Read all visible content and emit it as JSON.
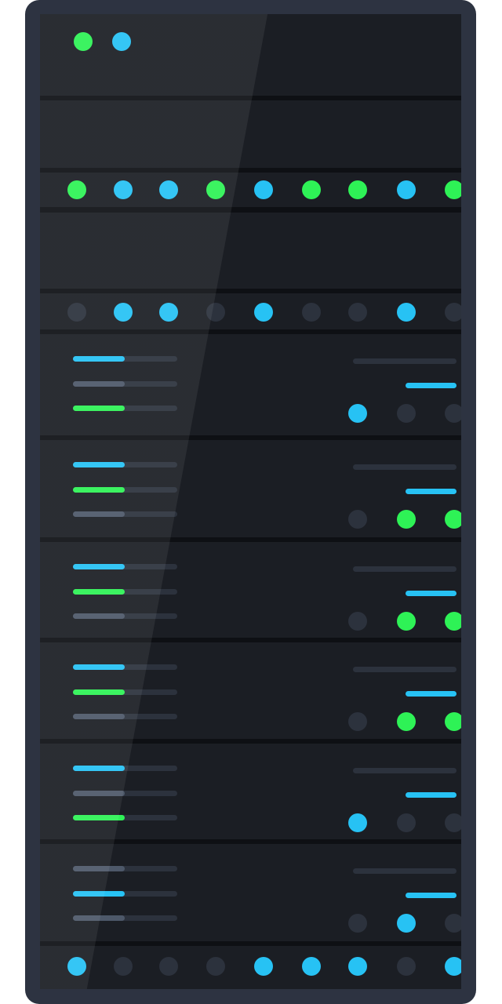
{
  "colors": {
    "frame": "#2d3341",
    "chassis": "#0e1014",
    "panel": "#1b1e24",
    "green": "#2ef256",
    "blue": "#27c2f4",
    "gray": "#4d5869",
    "off": "#2c323d"
  },
  "top_unit": {
    "leds": [
      "green",
      "blue"
    ]
  },
  "led_rows": [
    {
      "leds": [
        "green",
        "blue",
        "blue",
        "green",
        "blue",
        "green",
        "green",
        "blue",
        "green"
      ]
    },
    {
      "leds": [
        "off",
        "blue",
        "blue",
        "off",
        "blue",
        "off",
        "off",
        "blue",
        "off"
      ]
    },
    {
      "leds": [
        "blue",
        "off",
        "off",
        "off",
        "blue",
        "blue",
        "blue",
        "off",
        "blue"
      ]
    }
  ],
  "drive_units": [
    {
      "bars": [
        "blue",
        "gray",
        "green"
      ],
      "leds": [
        "blue",
        "off",
        "off"
      ]
    },
    {
      "bars": [
        "blue",
        "green",
        "gray"
      ],
      "leds": [
        "off",
        "green",
        "green"
      ]
    },
    {
      "bars": [
        "blue",
        "green",
        "gray"
      ],
      "leds": [
        "off",
        "green",
        "green"
      ]
    },
    {
      "bars": [
        "blue",
        "green",
        "gray"
      ],
      "leds": [
        "off",
        "green",
        "green"
      ]
    },
    {
      "bars": [
        "blue",
        "gray",
        "green"
      ],
      "leds": [
        "blue",
        "off",
        "off"
      ]
    },
    {
      "bars": [
        "gray",
        "blue",
        "gray"
      ],
      "leds": [
        "off",
        "blue",
        "off"
      ]
    }
  ]
}
